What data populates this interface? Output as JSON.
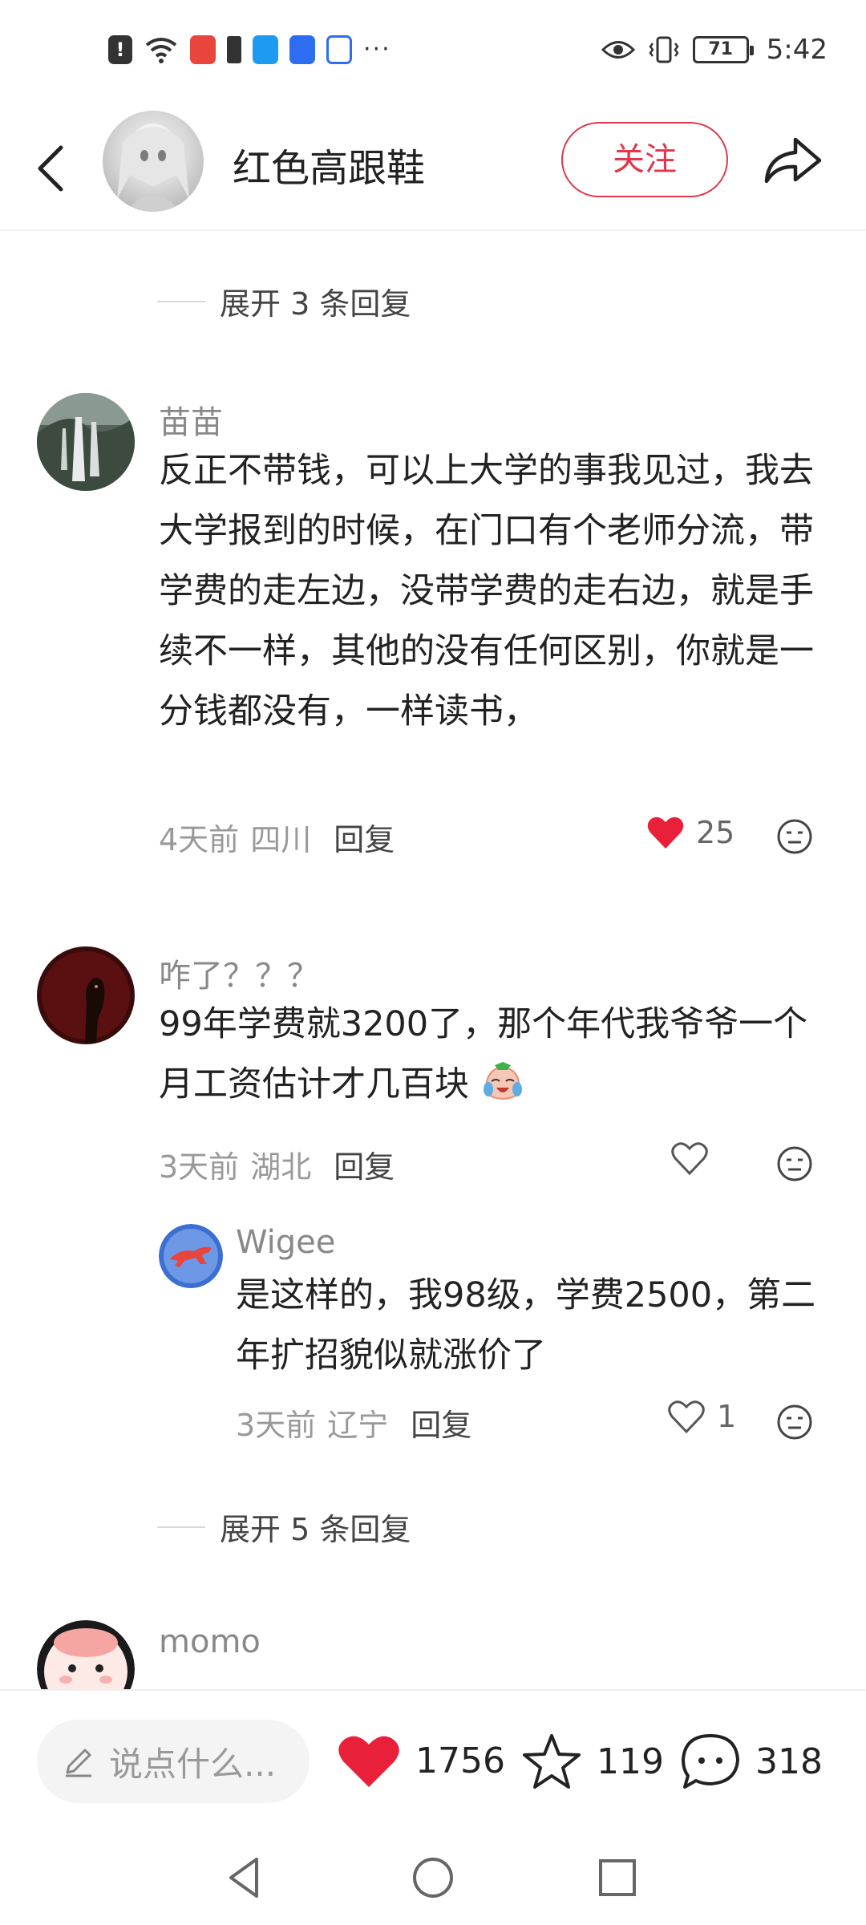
{
  "status_bar": {
    "alert_glyph": "!",
    "battery_level": "71",
    "time": "5:42",
    "more_glyph": "···"
  },
  "header": {
    "author_name": "红色高跟鞋",
    "follow_label": "关注"
  },
  "expand_top": {
    "label": "展开 3 条回复"
  },
  "comments": [
    {
      "name": "苗苗",
      "text": "反正不带钱，可以上大学的事我见过，我去大学报到的时候，在门口有个老师分流，带学费的走左边，没带学费的走右边，就是手续不一样，其他的没有任何区别，你就是一分钱都没有，一样读书，",
      "time": "4天前",
      "location": "四川",
      "reply_label": "回复",
      "likes": "25",
      "liked": true
    },
    {
      "name": "咋了？？？",
      "text": "99年学费就3200了，那个年代我爷爷一个月工资估计才几百块",
      "time": "3天前",
      "location": "湖北",
      "reply_label": "回复",
      "likes": "",
      "liked": false,
      "emoji_icon": "crying-laughing-emoji"
    },
    {
      "name": "momo"
    }
  ],
  "sub_reply": {
    "name": "Wigee",
    "text": "是这样的，我98级，学费2500，第二年扩招貌似就涨价了",
    "time": "3天前",
    "location": "辽宁",
    "reply_label": "回复",
    "likes": "1",
    "liked": false
  },
  "expand_bottom": {
    "label": "展开 5 条回复"
  },
  "action_bar": {
    "input_placeholder": "说点什么...",
    "like_count": "1756",
    "star_count": "119",
    "comment_count": "318"
  },
  "colors": {
    "accent_red": "#e0384a",
    "like_red": "#e8203a",
    "text_main": "#222222",
    "text_muted": "#999999"
  },
  "icons": {
    "nav_back": "triangle-back-icon",
    "nav_home": "circle-home-icon",
    "nav_recents": "square-recents-icon"
  }
}
